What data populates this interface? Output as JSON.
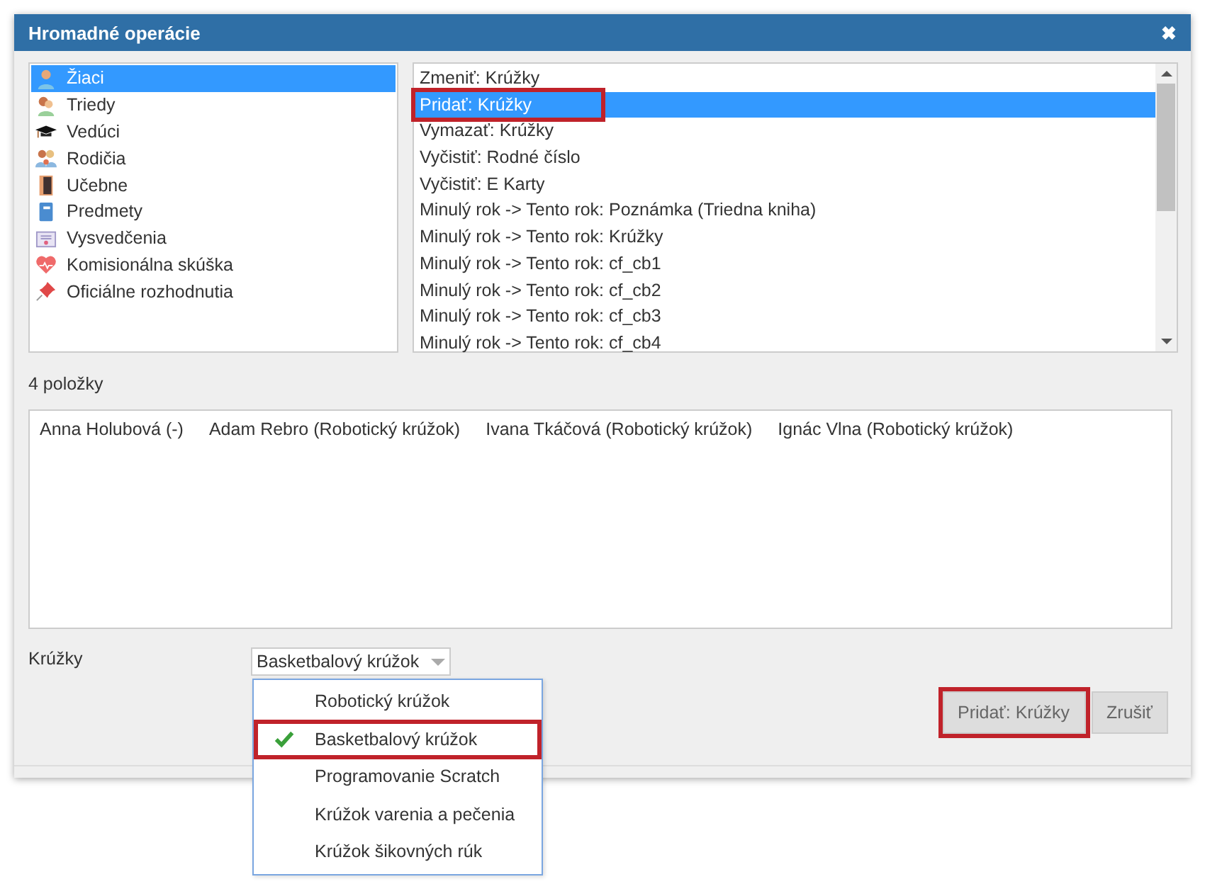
{
  "window": {
    "title": "Hromadné operácie",
    "close": "✖"
  },
  "categories": [
    {
      "label": "Žiaci",
      "selected": true
    },
    {
      "label": "Triedy",
      "selected": false
    },
    {
      "label": "Vedúci",
      "selected": false
    },
    {
      "label": "Rodičia",
      "selected": false
    },
    {
      "label": "Učebne",
      "selected": false
    },
    {
      "label": "Predmety",
      "selected": false
    },
    {
      "label": "Vysvedčenia",
      "selected": false
    },
    {
      "label": "Komisionálna skúška",
      "selected": false
    },
    {
      "label": "Oficiálne rozhodnutia",
      "selected": false
    }
  ],
  "operations": [
    {
      "label": "Zmeniť: Krúžky",
      "selected": false,
      "highlighted": false
    },
    {
      "label": "Pridať: Krúžky",
      "selected": true,
      "highlighted": true
    },
    {
      "label": "Vymazať: Krúžky",
      "selected": false,
      "highlighted": false
    },
    {
      "label": "Vyčistiť: Rodné číslo",
      "selected": false,
      "highlighted": false
    },
    {
      "label": "Vyčistiť: E Karty",
      "selected": false,
      "highlighted": false
    },
    {
      "label": "Minulý rok -> Tento rok: Poznámka (Triedna kniha)",
      "selected": false,
      "highlighted": false
    },
    {
      "label": "Minulý rok -> Tento rok: Krúžky",
      "selected": false,
      "highlighted": false
    },
    {
      "label": "Minulý rok -> Tento rok: cf_cb1",
      "selected": false,
      "highlighted": false
    },
    {
      "label": "Minulý rok -> Tento rok: cf_cb2",
      "selected": false,
      "highlighted": false
    },
    {
      "label": "Minulý rok -> Tento rok: cf_cb3",
      "selected": false,
      "highlighted": false
    },
    {
      "label": "Minulý rok -> Tento rok: cf_cb4",
      "selected": false,
      "highlighted": false
    }
  ],
  "count": "4 položky",
  "people": [
    "Anna Holubová (-)",
    "Adam Rebro (Robotický krúžok)",
    "Ivana Tkáčová (Robotický krúžok)",
    "Ignác Vlna (Robotický krúžok)"
  ],
  "field": {
    "label": "Krúžky",
    "value": "Basketbalový krúžok"
  },
  "dropdown": [
    {
      "label": "Robotický krúžok",
      "selected": false,
      "highlighted": false
    },
    {
      "label": "Basketbalový krúžok",
      "selected": true,
      "highlighted": true
    },
    {
      "label": "Programovanie Scratch",
      "selected": false,
      "highlighted": false
    },
    {
      "label": "Krúžok varenia a pečenia",
      "selected": false,
      "highlighted": false
    },
    {
      "label": "Krúžok šikovných rúk",
      "selected": false,
      "highlighted": false
    }
  ],
  "buttons": [
    {
      "label": "Pridať: Krúžky",
      "highlighted": true
    },
    {
      "label": "Zrušiť",
      "highlighted": false
    }
  ]
}
